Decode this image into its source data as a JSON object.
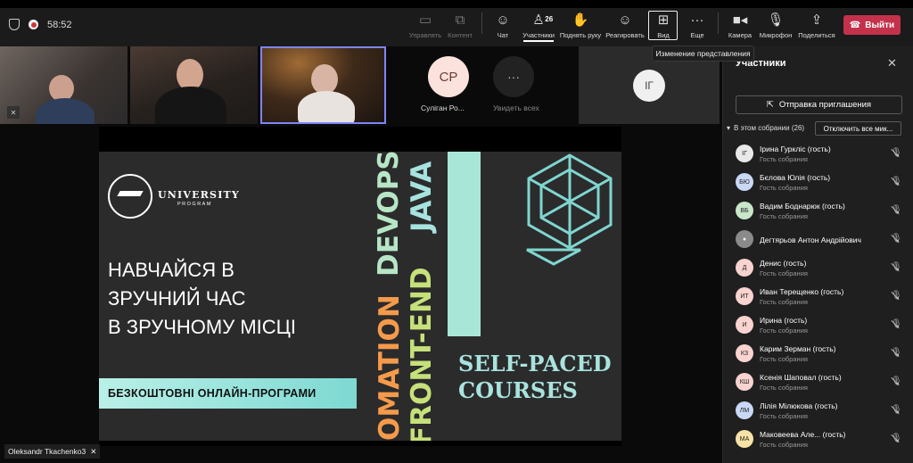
{
  "topbar": {
    "timer": "58:52",
    "controls": {
      "manage": "Управлять",
      "content": "Контент",
      "chat": "Чат",
      "participants": "Участники",
      "participants_count": "26",
      "raise_hand": "Поднять руку",
      "react": "Реагировать",
      "view": "Вид",
      "more": "Еще",
      "camera": "Камера",
      "mic": "Микрофон",
      "share": "Поделиться",
      "leave": "Выйти"
    },
    "tooltip": "Изменение представления"
  },
  "strip": {
    "tiles": [
      {
        "initials": "СР",
        "caption": "Суліган Ро..."
      },
      {
        "caption": "Увидеть всех"
      },
      {
        "initials": "ІГ"
      }
    ]
  },
  "slide": {
    "logo_line1": "UNIVERSITY",
    "logo_line2": "PROGRAM",
    "headline": [
      "НАВЧАЙСЯ В",
      "ЗРУЧНИЙ ЧАС",
      "В ЗРУЧНОМУ МІСЦІ"
    ],
    "free_programs": "БЕЗКОШТОВНІ ОНЛАЙН-ПРОГРАМИ",
    "vertical": {
      "automation": "OMATION",
      "frontend": "FRONT-END",
      "devops": "DEVOPS",
      "java": "JAVA"
    },
    "self_paced": [
      "SELF-PACED",
      "COURSES"
    ]
  },
  "presenter_label": "Oleksandr Tkachenko3",
  "panel": {
    "title": "Участники",
    "invite": "Отправка приглашения",
    "section": "В этом собрании (26)",
    "mute_all": "Отключить все мик...",
    "participants": [
      {
        "initials": "ІГ",
        "name": "Ірина Гуркліс (гость)",
        "role": "Гость собрания",
        "color": "#e9e9e9"
      },
      {
        "initials": "БЮ",
        "name": "Бєлова Юлія (гость)",
        "role": "Гость собрания",
        "color": "#c9d8f5"
      },
      {
        "initials": "ВБ",
        "name": "Вадим Боднарюк (гость)",
        "role": "Гость собрания",
        "color": "#c8e6c9"
      },
      {
        "initials": "",
        "name": "Дегтярьов Антон Андрійович",
        "role": "",
        "color": "#8a8a8a"
      },
      {
        "initials": "Д",
        "name": "Денис (гость)",
        "role": "Гость собрания",
        "color": "#f8d3cf"
      },
      {
        "initials": "ИТ",
        "name": "Иван Терещенко (гость)",
        "role": "Гость собрания",
        "color": "#f8d3cf"
      },
      {
        "initials": "И",
        "name": "Ирина (гость)",
        "role": "Гость собрания",
        "color": "#f8d3cf"
      },
      {
        "initials": "КЗ",
        "name": "Карим Зерман (гость)",
        "role": "Гость собрания",
        "color": "#f8d3cf"
      },
      {
        "initials": "КШ",
        "name": "Ксенія Шаповал (гость)",
        "role": "Гость собрания",
        "color": "#f8d3cf"
      },
      {
        "initials": "ЛМ",
        "name": "Лілія Мілюкова (гость)",
        "role": "Гость собрания",
        "color": "#c9d8f5"
      },
      {
        "initials": "МА",
        "name": "Маковеева Але...   (гость)",
        "role": "Гость собрания",
        "color": "#f7e3a6"
      }
    ]
  }
}
